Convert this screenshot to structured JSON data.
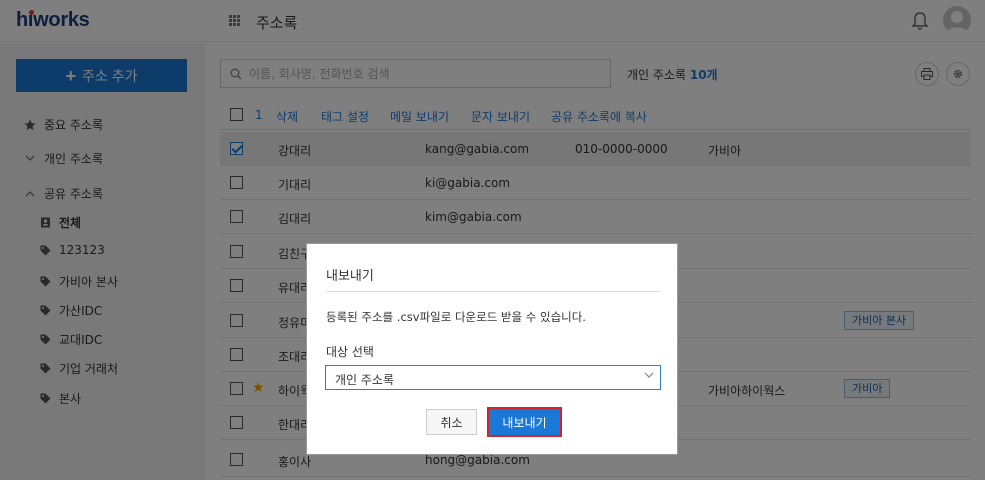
{
  "header": {
    "logo": "hiworks",
    "app_title": "주소록"
  },
  "sidebar": {
    "add_button": "주소 추가",
    "items": [
      {
        "label": "중요 주소록",
        "icon": "star-icon"
      },
      {
        "label": "개인 주소록",
        "icon": "chevron-down-icon"
      },
      {
        "label": "공유 주소록",
        "icon": "chevron-up-icon"
      }
    ],
    "shared_items": [
      {
        "label": "전체",
        "icon": "address-book-icon"
      },
      {
        "label": "123123",
        "icon": "tag-icon"
      },
      {
        "label": "가비아 본사",
        "icon": "tag-icon"
      },
      {
        "label": "가산IDC",
        "icon": "tag-icon"
      },
      {
        "label": "교대IDC",
        "icon": "tag-icon"
      },
      {
        "label": "기업 거래처",
        "icon": "tag-icon"
      },
      {
        "label": "본사",
        "icon": "tag-icon"
      }
    ]
  },
  "search": {
    "placeholder": "이름, 회사명, 전화번호 검색",
    "value": ""
  },
  "count": {
    "label": "개인 주소록",
    "value": "10개"
  },
  "toolbar": {
    "selected_count": "1",
    "actions": [
      "삭제",
      "태그 설정",
      "메일 보내기",
      "문자 보내기",
      "공유 주소록에 복사"
    ]
  },
  "rows": [
    {
      "name": "강대리",
      "email": "kang@gabia.com",
      "phone": "010-0000-0000",
      "company": "가비아",
      "tag": "",
      "checked": true,
      "starred": false
    },
    {
      "name": "기대리",
      "email": "ki@gabia.com",
      "phone": "",
      "company": "",
      "tag": "",
      "checked": false,
      "starred": false
    },
    {
      "name": "김대리",
      "email": "kim@gabia.com",
      "phone": "",
      "company": "",
      "tag": "",
      "checked": false,
      "starred": false
    },
    {
      "name": "김친구",
      "email": "",
      "phone": "",
      "company": "",
      "tag": "",
      "checked": false,
      "starred": false
    },
    {
      "name": "유대리",
      "email": "",
      "phone": "",
      "company": "",
      "tag": "",
      "checked": false,
      "starred": false
    },
    {
      "name": "정유미",
      "email": "",
      "phone": "",
      "company": "",
      "tag": "가비아 본사",
      "checked": false,
      "starred": false
    },
    {
      "name": "조대리",
      "email": "",
      "phone": "",
      "company": "",
      "tag": "",
      "checked": false,
      "starred": false
    },
    {
      "name": "하이웍",
      "email": "",
      "phone": "",
      "company": "가비아하이웍스",
      "tag": "가비아",
      "checked": false,
      "starred": true
    },
    {
      "name": "한대리",
      "email": "",
      "phone": "",
      "company": "",
      "tag": "",
      "checked": false,
      "starred": false
    },
    {
      "name": "홍이사",
      "email": "hong@gabia.com",
      "phone": "",
      "company": "",
      "tag": "",
      "checked": false,
      "starred": false
    }
  ],
  "modal": {
    "title": "내보내기",
    "description": "등록된 주소를 .csv파일로 다운로드 받을 수 있습니다.",
    "target_label": "대상 선택",
    "selected_option": "개인 주소록",
    "cancel": "취소",
    "export": "내보내기"
  }
}
